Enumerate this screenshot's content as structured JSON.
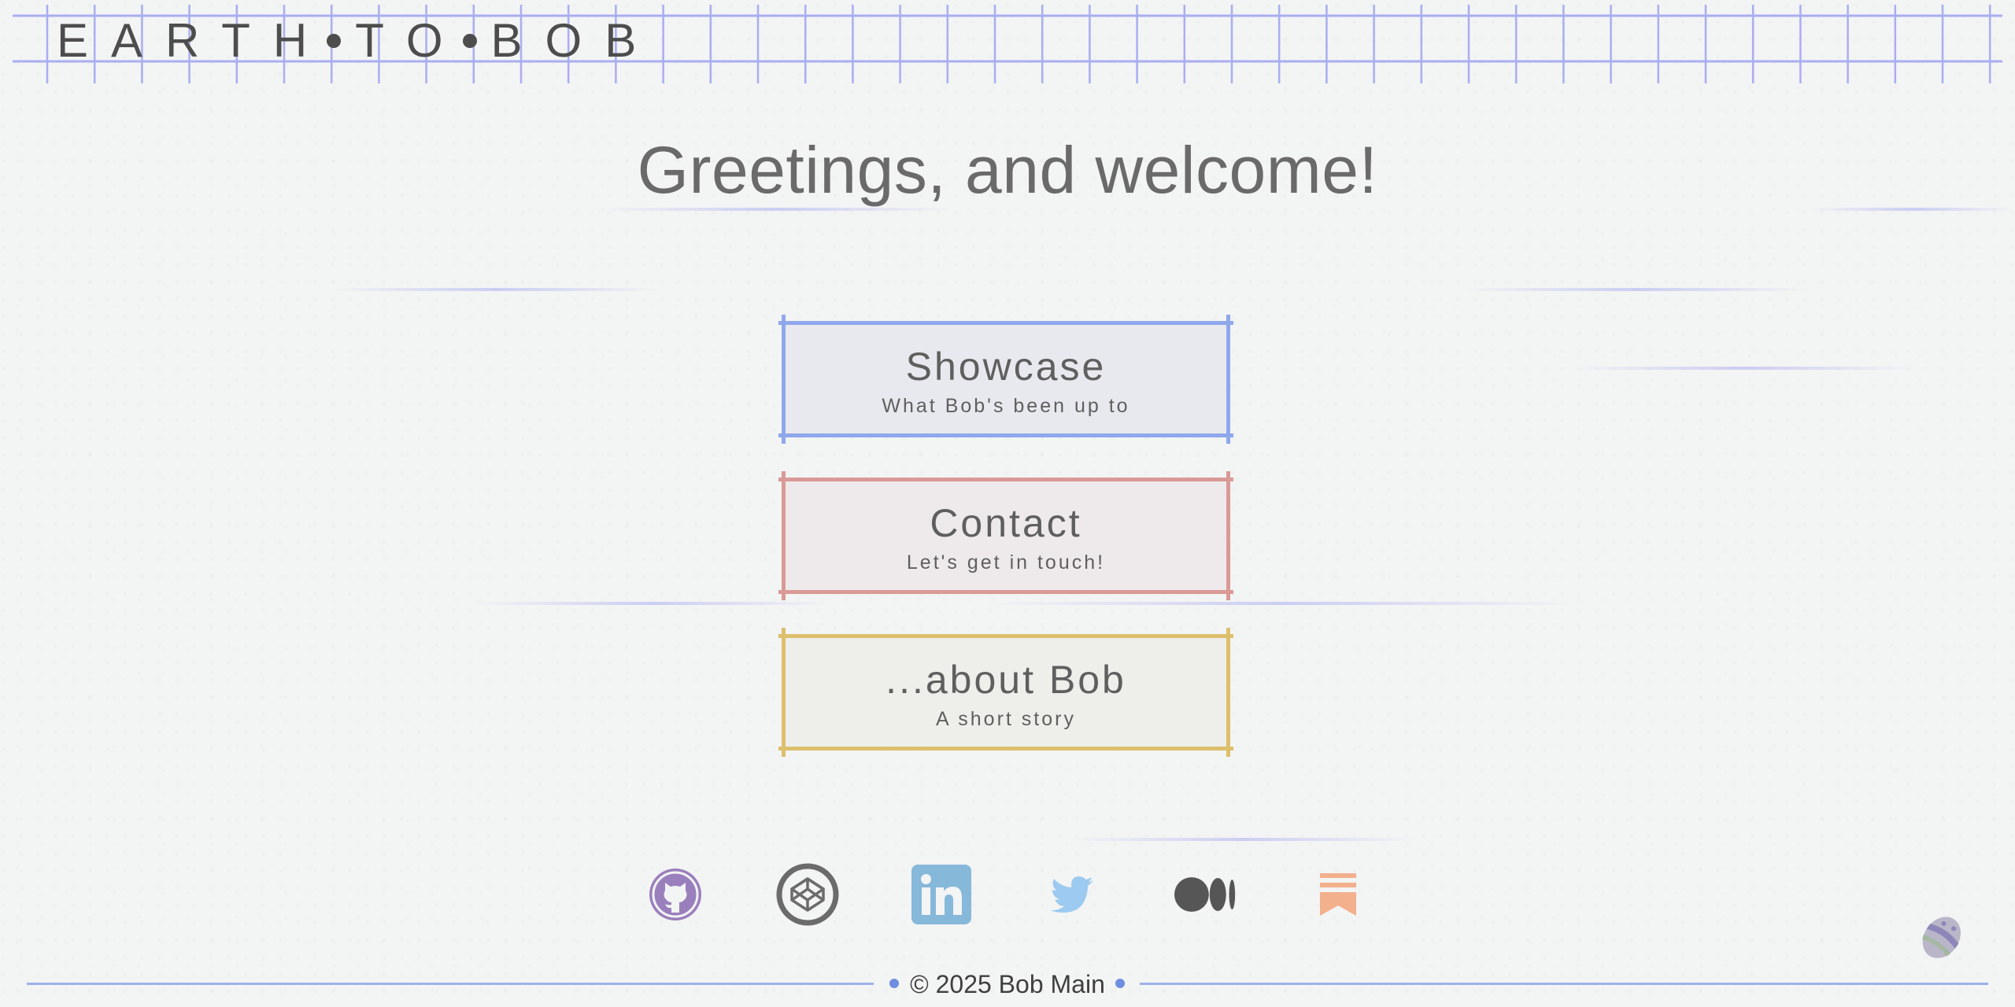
{
  "header": {
    "logo_parts": [
      "EARTH",
      "TO",
      "BOB"
    ]
  },
  "hero": {
    "title": "Greetings, and welcome!"
  },
  "nav": [
    {
      "title": "Showcase",
      "subtitle": "What Bob's been up to",
      "accent": "#8fa8ec",
      "fill": "#e8e9ee"
    },
    {
      "title": "Contact",
      "subtitle": "Let's get in touch!",
      "accent": "#d99a97",
      "fill": "#eeeaeb"
    },
    {
      "title": "...about Bob",
      "subtitle": "A short story",
      "accent": "#ddbf6c",
      "fill": "#eeeeea"
    }
  ],
  "social": [
    {
      "name": "github",
      "color": "#9a7fbd"
    },
    {
      "name": "codepen",
      "color": "#6b6b6b"
    },
    {
      "name": "linkedin",
      "color": "#86b8da"
    },
    {
      "name": "twitter",
      "color": "#9ccaf0"
    },
    {
      "name": "medium",
      "color": "#565656"
    },
    {
      "name": "substack",
      "color": "#f3b08c"
    }
  ],
  "footer": {
    "copyright": "© 2025 Bob Main",
    "line_color": "#9db1ea"
  },
  "colors": {
    "background": "#f3f4f4",
    "grid": "#a9aef0",
    "text": "#575757"
  }
}
